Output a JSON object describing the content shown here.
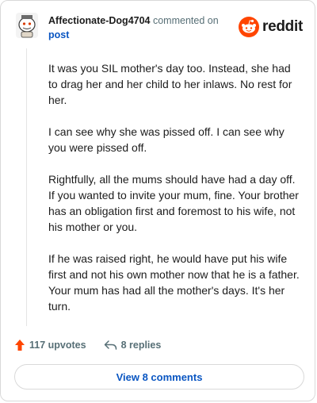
{
  "comment": {
    "username": "Affectionate-Dog4704",
    "action_text": "commented on",
    "post_link": "post",
    "avatar_icon": "snoo-avatar-icon",
    "paragraphs": [
      "It was you SIL mother's day too. Instead, she had to drag her and her child to her inlaws. No rest for her.",
      "I can see why she was pissed off. I can see why you were pissed off.",
      "Rightfully, all the mums should have had a day off. If you wanted to invite your mum, fine. Your brother has an obligation first and foremost to his wife, not his mother or you.",
      "If he was raised right, he would have put his wife first and not his own mother now that he is a father. Your mum has had all the mother's days. It's her turn."
    ]
  },
  "brand": {
    "wordmark": "reddit",
    "icon": "reddit-logo-icon",
    "accent_color": "#ff4500"
  },
  "footer": {
    "upvotes_label": "117 upvotes",
    "replies_label": "8 replies",
    "view_comments_label": "View 8 comments",
    "upvote_icon": "upvote-arrow-icon",
    "reply_icon": "reply-arrow-icon"
  }
}
